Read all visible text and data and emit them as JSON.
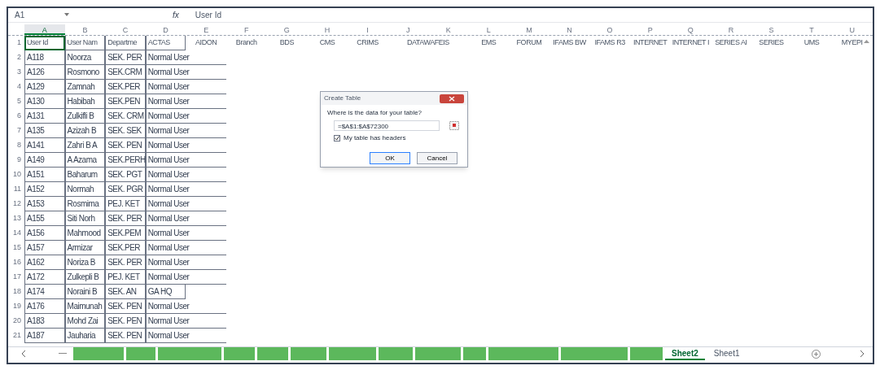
{
  "formula_bar": {
    "name_box": "A1",
    "fx": "fx",
    "formula": "User Id"
  },
  "columns": [
    {
      "label": "A",
      "selected": true
    },
    {
      "label": "B",
      "selected": false
    },
    {
      "label": "C",
      "selected": false
    },
    {
      "label": "D",
      "selected": false
    },
    {
      "label": "E",
      "selected": false
    },
    {
      "label": "F",
      "selected": false
    },
    {
      "label": "G",
      "selected": false
    },
    {
      "label": "H",
      "selected": false
    },
    {
      "label": "I",
      "selected": false
    },
    {
      "label": "J",
      "selected": false
    },
    {
      "label": "K",
      "selected": false
    },
    {
      "label": "L",
      "selected": false
    },
    {
      "label": "M",
      "selected": false
    },
    {
      "label": "N",
      "selected": false
    },
    {
      "label": "O",
      "selected": false
    },
    {
      "label": "P",
      "selected": false
    },
    {
      "label": "Q",
      "selected": false
    },
    {
      "label": "R",
      "selected": false
    },
    {
      "label": "S",
      "selected": false
    },
    {
      "label": "T",
      "selected": false
    },
    {
      "label": "U",
      "selected": false
    }
  ],
  "rows": [
    {
      "number": "1",
      "cells": [
        {
          "text": "User Id",
          "selected": true
        },
        {
          "text": "User Nam",
          "selected": false
        },
        {
          "text": "Departme",
          "selected": false
        },
        {
          "text": "ACTAS",
          "selected": false
        },
        {
          "text": "AIDON",
          "selected": false
        },
        {
          "text": "Branch",
          "selected": false
        },
        {
          "text": "BDS",
          "selected": false
        },
        {
          "text": "CMS",
          "selected": false
        },
        {
          "text": "CRIMS",
          "selected": false
        },
        {
          "text": "DATAWAFEIS",
          "selected": false,
          "overflow": true
        },
        {
          "text": "EMS",
          "selected": false
        },
        {
          "text": "FORUM",
          "selected": false
        },
        {
          "text": "IFAMS BW",
          "selected": false
        },
        {
          "text": "IFAMS R3",
          "selected": false
        },
        {
          "text": "INTERNET",
          "selected": false
        },
        {
          "text": "INTERNET I",
          "selected": false
        },
        {
          "text": "SERIES AI",
          "selected": false
        },
        {
          "text": "SERIES",
          "selected": false
        },
        {
          "text": "UMS",
          "selected": false
        },
        {
          "text": "MYEPI",
          "selected": false
        }
      ]
    },
    {
      "number": "2",
      "cells": [
        {
          "text": "A118",
          "selected": false
        },
        {
          "text": "Noorza",
          "selected": false
        },
        {
          "text": "SEK. PER",
          "selected": false
        },
        {
          "text": "Normal User",
          "selected": false,
          "overflow": true
        }
      ]
    },
    {
      "number": "3",
      "cells": [
        {
          "text": "A126",
          "selected": false
        },
        {
          "text": "Rosmono",
          "selected": false
        },
        {
          "text": "SEK.CRM",
          "selected": false
        },
        {
          "text": "Normal User",
          "selected": false,
          "overflow": true
        }
      ]
    },
    {
      "number": "4",
      "cells": [
        {
          "text": "A129",
          "selected": false
        },
        {
          "text": "Zamnah",
          "selected": false
        },
        {
          "text": "SEK.PER",
          "selected": false
        },
        {
          "text": "Normal User",
          "selected": false,
          "overflow": true
        }
      ]
    },
    {
      "number": "5",
      "cells": [
        {
          "text": "A130",
          "selected": false
        },
        {
          "text": "Habibah",
          "selected": false
        },
        {
          "text": "SEK.PEN",
          "selected": false
        },
        {
          "text": "Normal User",
          "selected": false,
          "overflow": true
        }
      ]
    },
    {
      "number": "6",
      "cells": [
        {
          "text": "A131",
          "selected": false
        },
        {
          "text": "Zulkifli B",
          "selected": false
        },
        {
          "text": "SEK. CRM",
          "selected": false
        },
        {
          "text": "Normal User",
          "selected": false,
          "overflow": true
        }
      ]
    },
    {
      "number": "7",
      "cells": [
        {
          "text": "A135",
          "selected": false
        },
        {
          "text": "Azizah B",
          "selected": false
        },
        {
          "text": "SEK. SEK",
          "selected": false
        },
        {
          "text": "Normal User",
          "selected": false,
          "overflow": true
        }
      ]
    },
    {
      "number": "8",
      "cells": [
        {
          "text": "A141",
          "selected": false
        },
        {
          "text": "Zahri B A",
          "selected": false
        },
        {
          "text": "SEK. PEN",
          "selected": false
        },
        {
          "text": "Normal User",
          "selected": false,
          "overflow": true
        }
      ]
    },
    {
      "number": "9",
      "cells": [
        {
          "text": "A149",
          "selected": false
        },
        {
          "text": "A Azama",
          "selected": false
        },
        {
          "text": "SEK.PERH",
          "selected": false
        },
        {
          "text": "Normal User",
          "selected": false,
          "overflow": true
        }
      ]
    },
    {
      "number": "10",
      "cells": [
        {
          "text": "A151",
          "selected": false
        },
        {
          "text": "Baharum",
          "selected": false
        },
        {
          "text": "SEK. PGT",
          "selected": false
        },
        {
          "text": "Normal User",
          "selected": false,
          "overflow": true
        }
      ]
    },
    {
      "number": "11",
      "cells": [
        {
          "text": "A152",
          "selected": false
        },
        {
          "text": "Normah",
          "selected": false
        },
        {
          "text": "SEK. PGR",
          "selected": false
        },
        {
          "text": "Normal User",
          "selected": false,
          "overflow": true
        }
      ]
    },
    {
      "number": "12",
      "cells": [
        {
          "text": "A153",
          "selected": false
        },
        {
          "text": "Rosmima",
          "selected": false
        },
        {
          "text": "PEJ. KET",
          "selected": false
        },
        {
          "text": "Normal User",
          "selected": false,
          "overflow": true
        }
      ]
    },
    {
      "number": "13",
      "cells": [
        {
          "text": "A155",
          "selected": false
        },
        {
          "text": "Siti Norh",
          "selected": false
        },
        {
          "text": "SEK. PER",
          "selected": false
        },
        {
          "text": "Normal User",
          "selected": false,
          "overflow": true
        }
      ]
    },
    {
      "number": "14",
      "cells": [
        {
          "text": "A156",
          "selected": false
        },
        {
          "text": "Mahmood",
          "selected": false
        },
        {
          "text": "SEK.PEM",
          "selected": false
        },
        {
          "text": "Normal User",
          "selected": false,
          "overflow": true
        }
      ]
    },
    {
      "number": "15",
      "cells": [
        {
          "text": "A157",
          "selected": false
        },
        {
          "text": "Armizar",
          "selected": false
        },
        {
          "text": "SEK.PER",
          "selected": false
        },
        {
          "text": "Normal User",
          "selected": false,
          "overflow": true
        }
      ]
    },
    {
      "number": "16",
      "cells": [
        {
          "text": "A162",
          "selected": false
        },
        {
          "text": "Noriza B",
          "selected": false
        },
        {
          "text": "SEK. PER",
          "selected": false
        },
        {
          "text": "Normal User",
          "selected": false,
          "overflow": true
        }
      ]
    },
    {
      "number": "17",
      "cells": [
        {
          "text": "A172",
          "selected": false
        },
        {
          "text": "Zulkepli B",
          "selected": false
        },
        {
          "text": "PEJ. KET",
          "selected": false
        },
        {
          "text": "Normal User",
          "selected": false,
          "overflow": true
        }
      ]
    },
    {
      "number": "18",
      "cells": [
        {
          "text": "A174",
          "selected": false
        },
        {
          "text": "Noraini B",
          "selected": false
        },
        {
          "text": "SEK. AN",
          "selected": false
        },
        {
          "text": "GA HQ",
          "selected": false
        }
      ]
    },
    {
      "number": "19",
      "cells": [
        {
          "text": "A176",
          "selected": false
        },
        {
          "text": "Maimunah",
          "selected": false
        },
        {
          "text": "SEK. PEN",
          "selected": false
        },
        {
          "text": "Normal User",
          "selected": false,
          "overflow": true
        }
      ]
    },
    {
      "number": "20",
      "cells": [
        {
          "text": "A183",
          "selected": false
        },
        {
          "text": "Mohd Zai",
          "selected": false
        },
        {
          "text": "SEK. PEN",
          "selected": false
        },
        {
          "text": "Normal User",
          "selected": false,
          "overflow": true
        }
      ]
    },
    {
      "number": "21",
      "cells": [
        {
          "text": "A187",
          "selected": false
        },
        {
          "text": "Jauharia",
          "selected": false
        },
        {
          "text": "SEK. PEN",
          "selected": false
        },
        {
          "text": "Normal User",
          "selected": false,
          "overflow": true
        }
      ]
    }
  ],
  "dialog": {
    "title": "Create Table",
    "prompt": "Where is the data for your table?",
    "range": "=$A$1:$A$72300",
    "checkbox": {
      "label": "My table has headers",
      "checked": true
    },
    "buttons": [
      {
        "label": "OK",
        "default": true
      },
      {
        "label": "Cancel",
        "default": false
      }
    ]
  },
  "sheet_tabs": [
    {
      "color": "#5cb85c",
      "selected": false
    },
    {
      "color": "#5cb85c",
      "selected": false
    },
    {
      "color": "#5cb85c",
      "selected": false
    },
    {
      "color": "#5cb85c",
      "selected": false
    },
    {
      "color": "#5cb85c",
      "selected": false
    },
    {
      "color": "#5cb85c",
      "selected": false
    },
    {
      "color": "#5cb85c",
      "selected": false
    },
    {
      "color": "#5cb85c",
      "selected": false
    },
    {
      "color": "#5cb85c",
      "selected": false
    },
    {
      "color": "#5cb85c",
      "selected": false
    },
    {
      "color": "#5cb85c",
      "selected": false
    },
    {
      "color": "#5cb85c",
      "selected": false
    },
    {
      "color": "#5cb85c",
      "selected": false
    },
    {
      "label": "Sheet2",
      "selected": true
    },
    {
      "label": "Sheet1",
      "selected": false
    }
  ]
}
